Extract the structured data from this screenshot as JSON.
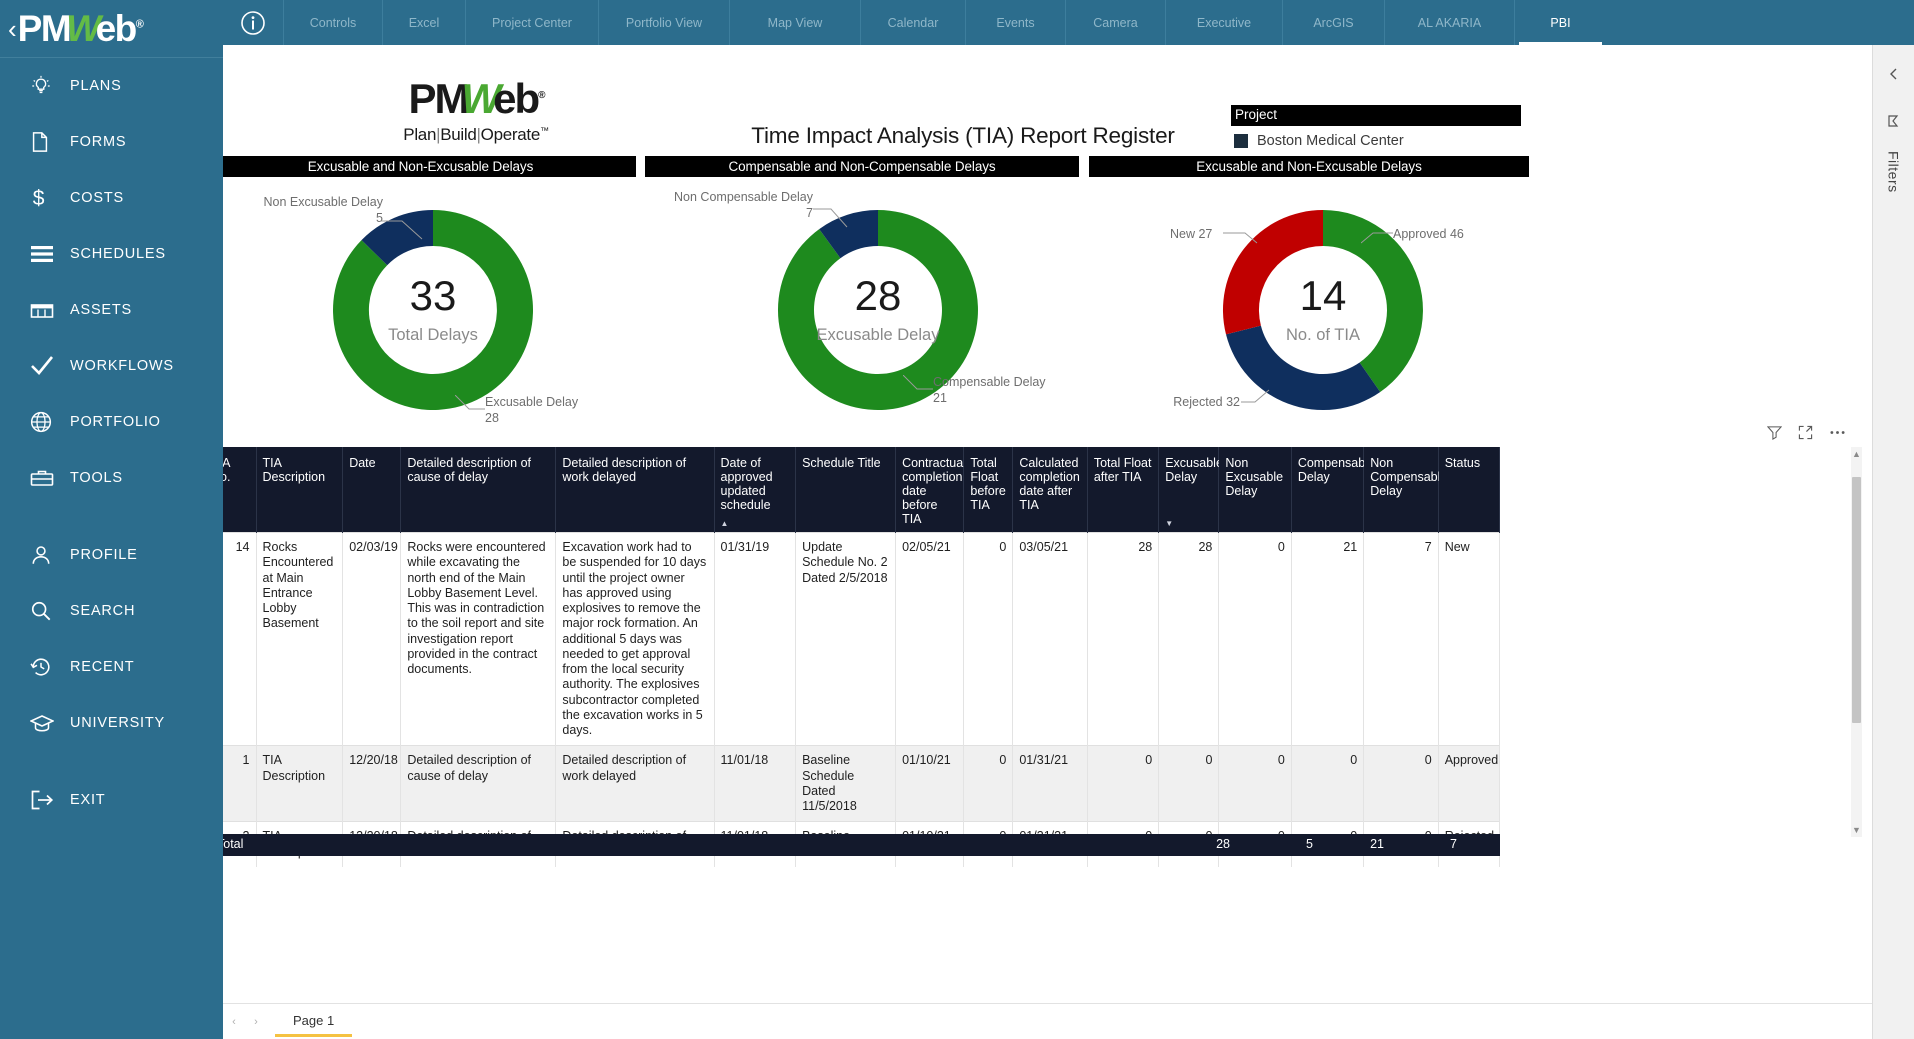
{
  "app": {
    "logo": {
      "prefix": "PM",
      "mid": "W",
      "suffix": "eb",
      "reg": "®",
      "chevron": "‹"
    },
    "tagline": {
      "a": "Plan",
      "b": "Build",
      "c": "Operate",
      "tm": "™"
    }
  },
  "topbar": {
    "info_icon": "info-icon",
    "tabs": [
      {
        "label": "Controls",
        "active": false
      },
      {
        "label": "Excel",
        "active": false
      },
      {
        "label": "Project Center",
        "active": false
      },
      {
        "label": "Portfolio View",
        "active": false
      },
      {
        "label": "Map View",
        "active": false
      },
      {
        "label": "Calendar",
        "active": false
      },
      {
        "label": "Events",
        "active": false
      },
      {
        "label": "Camera",
        "active": false
      },
      {
        "label": "Executive",
        "active": false
      },
      {
        "label": "ArcGIS",
        "active": false
      },
      {
        "label": "AL AKARIA",
        "active": false
      },
      {
        "label": "PBI",
        "active": true
      }
    ]
  },
  "sidebar": {
    "items": [
      {
        "label": "PLANS",
        "icon": "lightbulb-icon"
      },
      {
        "label": "FORMS",
        "icon": "document-icon"
      },
      {
        "label": "COSTS",
        "icon": "dollar-icon"
      },
      {
        "label": "SCHEDULES",
        "icon": "list-icon"
      },
      {
        "label": "ASSETS",
        "icon": "building-icon"
      },
      {
        "label": "WORKFLOWS",
        "icon": "check-icon"
      },
      {
        "label": "PORTFOLIO",
        "icon": "globe-icon"
      },
      {
        "label": "TOOLS",
        "icon": "toolbox-icon"
      },
      {
        "label": "PROFILE",
        "icon": "user-icon"
      },
      {
        "label": "SEARCH",
        "icon": "search-icon"
      },
      {
        "label": "RECENT",
        "icon": "clock-icon"
      },
      {
        "label": "UNIVERSITY",
        "icon": "graduation-icon"
      },
      {
        "label": "EXIT",
        "icon": "exit-icon"
      }
    ]
  },
  "rightrail": {
    "collapse_icon": "chevron-left-icon",
    "bookmark_icon": "bookmark-icon",
    "filters_label": "Filters"
  },
  "report": {
    "title": "Time Impact Analysis (TIA) Report Register",
    "legend_title": "Project",
    "legend_value": "Boston Medical Center",
    "legend_color": "#1c2e3e"
  },
  "chart_data": [
    {
      "type": "pie",
      "title": "Excusable and Non-Excusable Delays",
      "center_value": "33",
      "center_label": "Total Delays",
      "labels": [
        "Excusable Delay",
        "Non Excusable Delay"
      ],
      "values": [
        28,
        5
      ],
      "colors": [
        "#1e8a1e",
        "#0f2f5e"
      ],
      "annotations": [
        {
          "text": "Non Excusable Delay",
          "value": "5"
        },
        {
          "text": "Excusable Delay",
          "value": "28"
        }
      ],
      "legend": "callout"
    },
    {
      "type": "pie",
      "title": "Compensable and Non-Compensable Delays",
      "center_value": "28",
      "center_label": "Excusable Delay",
      "labels": [
        "Compensable Delay",
        "Non Compensable Delay"
      ],
      "values": [
        21,
        7
      ],
      "colors": [
        "#1e8a1e",
        "#0f2f5e"
      ],
      "annotations": [
        {
          "text": "Non Compensable Delay",
          "value": "7"
        },
        {
          "text": "Compensable Delay",
          "value": "21"
        }
      ],
      "legend": "callout"
    },
    {
      "type": "pie",
      "title": "Excusable and Non-Excusable Delays",
      "center_value": "14",
      "center_label": "No. of TIA",
      "labels": [
        "Approved",
        "Rejected",
        "New"
      ],
      "values": [
        46,
        32,
        27
      ],
      "colors": [
        "#1e8a1e",
        "#0f2f5e",
        "#c00000"
      ],
      "annotations": [
        {
          "text": "New 27"
        },
        {
          "text": "Approved 46"
        },
        {
          "text": "Rejected 32"
        }
      ],
      "legend": "callout"
    }
  ],
  "table_tools": {
    "filter_icon": "filter-icon",
    "focus_icon": "focus-mode-icon",
    "more_icon": "more-options-icon"
  },
  "table": {
    "columns": [
      {
        "label": "TIA No.",
        "sort": ""
      },
      {
        "label": "TIA Description",
        "sort": ""
      },
      {
        "label": "Date",
        "sort": ""
      },
      {
        "label": "Detailed description of cause of delay",
        "sort": ""
      },
      {
        "label": "Detailed description of work delayed",
        "sort": ""
      },
      {
        "label": "Date of approved updated schedule",
        "sort": "asc"
      },
      {
        "label": "Schedule Title",
        "sort": ""
      },
      {
        "label": "Contractual completion date before TIA",
        "sort": ""
      },
      {
        "label": "Total Float before TIA",
        "sort": ""
      },
      {
        "label": "Calculated completion date after TIA",
        "sort": ""
      },
      {
        "label": "Total Float after TIA",
        "sort": ""
      },
      {
        "label": "Excusable Delay",
        "sort": "desc"
      },
      {
        "label": "Non Excusable Delay",
        "sort": ""
      },
      {
        "label": "Compensable Delay",
        "sort": ""
      },
      {
        "label": "Non Compensable Delay",
        "sort": ""
      },
      {
        "label": "Status",
        "sort": ""
      }
    ],
    "rows": [
      {
        "tia_no": "14",
        "tia_description": "Rocks Encountered at Main Entrance Lobby Basement",
        "date": "02/03/19",
        "cause": "Rocks were encountered while excavating the north end of the Main Lobby Basement Level. This was in contradiction to the soil report and site investigation report provided in the contract documents.",
        "work_delayed": "Excavation work had to be suspended for 10 days until the project owner has approved using explosives to remove the major rock formation. An additional 5 days was needed to get approval from the local security authority. The explosives subcontractor completed the excavation works in 5 days.",
        "date_approved": "01/31/19",
        "schedule_title": "Update Schedule No. 2 Dated 2/5/2018",
        "contract_completion_before": "02/05/21",
        "float_before": "0",
        "calc_completion_after": "03/05/21",
        "float_after": "28",
        "excusable": "28",
        "non_excusable": "0",
        "compensable": "21",
        "non_compensable": "7",
        "status": "New"
      },
      {
        "tia_no": "1",
        "tia_description": "TIA Description",
        "date": "12/20/18",
        "cause": "Detailed description of cause of delay",
        "work_delayed": "Detailed description of work delayed",
        "date_approved": "11/01/18",
        "schedule_title": "Baseline Schedule Dated 11/5/2018",
        "contract_completion_before": "01/10/21",
        "float_before": "0",
        "calc_completion_after": "01/31/21",
        "float_after": "0",
        "excusable": "0",
        "non_excusable": "0",
        "compensable": "0",
        "non_compensable": "0",
        "status": "Approved"
      },
      {
        "tia_no": "2",
        "tia_description": "TIA Description",
        "date": "12/20/18",
        "cause": "Detailed description of",
        "work_delayed": "Detailed description of work",
        "date_approved": "11/01/18",
        "schedule_title": "Baseline Schedule",
        "contract_completion_before": "01/10/21",
        "float_before": "0",
        "calc_completion_after": "01/31/21",
        "float_after": "0",
        "excusable": "0",
        "non_excusable": "0",
        "compensable": "0",
        "non_compensable": "0",
        "status": "Rejected"
      }
    ],
    "total_row": {
      "label": "Total",
      "excusable": "28",
      "non_excusable": "5",
      "compensable": "21",
      "non_compensable": "7"
    }
  },
  "footer": {
    "prev": "‹",
    "next": "›",
    "page_tab": "Page 1"
  }
}
